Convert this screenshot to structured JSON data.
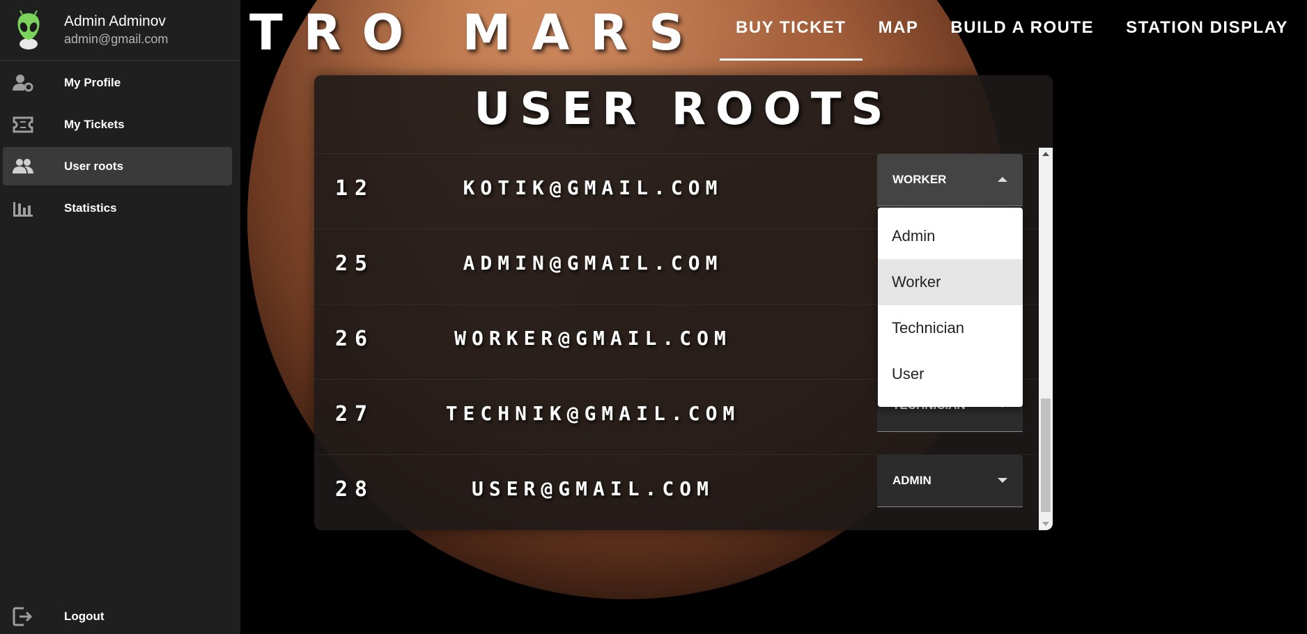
{
  "app": {
    "logo": "TRO MARS"
  },
  "user": {
    "name": "Admin Adminov",
    "email": "admin@gmail.com"
  },
  "sidebar": {
    "items": [
      {
        "label": "My Profile",
        "icon": "user-cog-icon"
      },
      {
        "label": "My Tickets",
        "icon": "ticket-icon"
      },
      {
        "label": "User roots",
        "icon": "users-icon",
        "active": true
      },
      {
        "label": "Statistics",
        "icon": "bar-chart-icon"
      }
    ],
    "logout_label": "Logout"
  },
  "topnav": {
    "items": [
      {
        "label": "BUY TICKET",
        "active": true
      },
      {
        "label": "MAP"
      },
      {
        "label": "BUILD A ROUTE"
      },
      {
        "label": "STATION DISPLAY"
      }
    ]
  },
  "panel": {
    "title": "USER ROOTS",
    "rows": [
      {
        "id": "12",
        "email": "KOTIK@GMAIL.COM",
        "role": "WORKER"
      },
      {
        "id": "25",
        "email": "ADMIN@GMAIL.COM",
        "role": ""
      },
      {
        "id": "26",
        "email": "WORKER@GMAIL.COM",
        "role": ""
      },
      {
        "id": "27",
        "email": "TECHNIK@GMAIL.COM",
        "role": "TECHNICIAN"
      },
      {
        "id": "28",
        "email": "USER@GMAIL.COM",
        "role": "ADMIN"
      }
    ]
  },
  "dropdown": {
    "options": [
      "Admin",
      "Worker",
      "Technician",
      "User"
    ],
    "selected": "Worker"
  },
  "colors": {
    "sidebar_bg": "#1f1f1f",
    "active_nav": "#3a3a3a",
    "background": "#000000",
    "panel_bg": "#1e1a18"
  }
}
